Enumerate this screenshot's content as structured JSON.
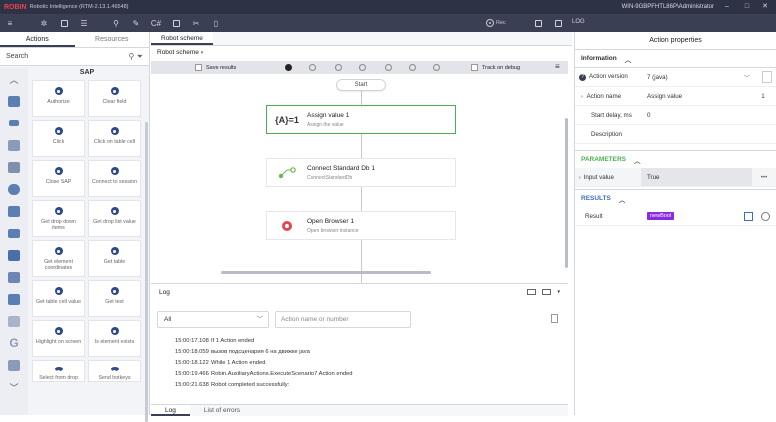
{
  "app": {
    "logo": "ROBIN",
    "title": "Robotic Intelligence (RTM-2.13.1.46548)",
    "user": "WIN-9GBPFHTL86P\\Administrator"
  },
  "toolbar": {
    "rec_label": "Rec",
    "log_label": "LOG"
  },
  "left": {
    "tabs": [
      "Actions",
      "Resources"
    ],
    "search_placeholder": "Search",
    "group_title": "SAP",
    "tiles": [
      "Authorize",
      "Clear field",
      "Click",
      "Click on table cell",
      "Close SAP",
      "Connect to session",
      "Get drop down items",
      "Get drop list value",
      "Get element coordinates",
      "Get table",
      "Get table cell value",
      "Get text",
      "Highlight on screen",
      "Is element exists",
      "Select from drop",
      "Send hotkeys"
    ]
  },
  "center": {
    "tab": "Robot scheme",
    "subtab": "Robot scheme",
    "save_results": "Save results",
    "track_on_debug": "Track on debug",
    "start_label": "Start",
    "nodes": [
      {
        "icon": "{A}=1",
        "title": "Assign value  1",
        "subtitle": "Assign the value"
      },
      {
        "icon": "",
        "title": "Connect Standard Db  1",
        "subtitle": "ConnectStandardDb"
      },
      {
        "icon": "",
        "title": "Open Browser  1",
        "subtitle": "Open browser instance"
      }
    ],
    "log": {
      "title": "Log",
      "filter_value": "All",
      "search_placeholder": "Action name or number",
      "rows": [
        {
          "time": "15:00:17.108",
          "text": "If 1 Action ended"
        },
        {
          "time": "15:00:18.059",
          "text": "вызов подсценария 6 на движке java"
        },
        {
          "time": "15:00:18.122",
          "text": "While 1 Action ended"
        },
        {
          "time": "15:00:19.466",
          "text": "Robin.AuxiliaryActions.ExecuteScenario7 Action ended"
        },
        {
          "time": "15:00:21.638",
          "text": "Robot completed successfully:"
        }
      ],
      "tabs": [
        "Log",
        "List of errors"
      ]
    }
  },
  "right": {
    "title": "Action properties",
    "info_section": "Information",
    "rows": [
      {
        "key": "Action version",
        "value": "7 (java)"
      },
      {
        "key": "Action name",
        "value": "Assign value",
        "extra": "1"
      },
      {
        "key": "Start delay, ms",
        "value": "0"
      },
      {
        "key": "Description",
        "value": ""
      }
    ],
    "params_section": "PARAMETERS",
    "input_key": "Input value",
    "input_value": "True",
    "results_section": "RESULTS",
    "result_key": "Result",
    "result_value": "newBool"
  }
}
